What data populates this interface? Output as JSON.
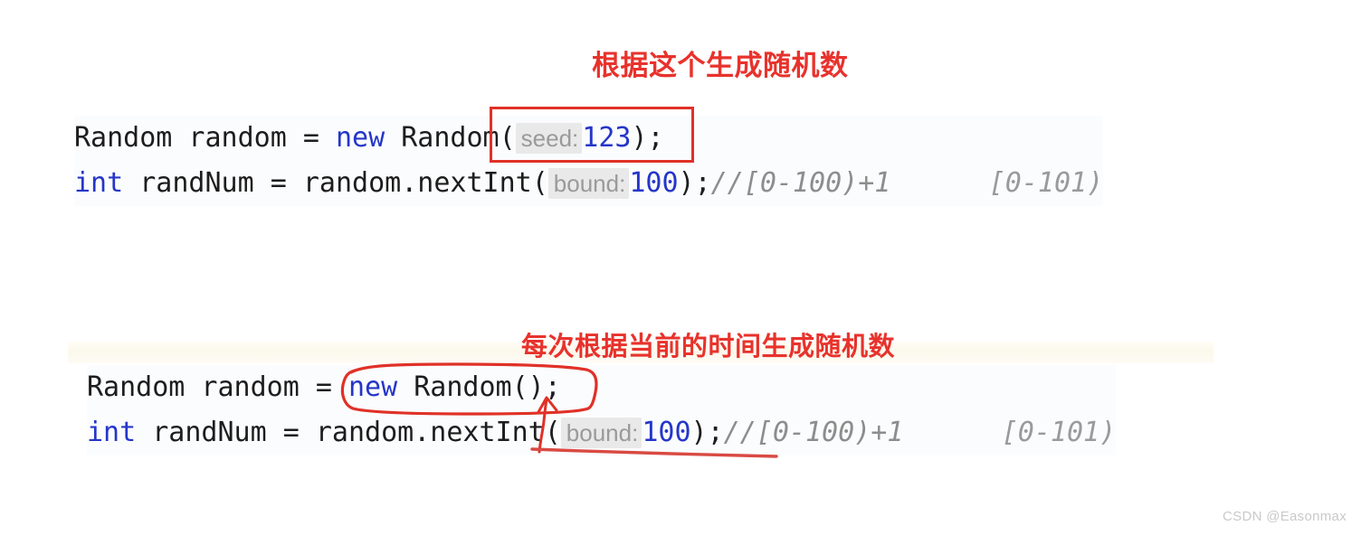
{
  "watermark": {
    "text": "CSDN @Easonmax"
  },
  "annotations": {
    "top": {
      "text": "根据这个生成随机数",
      "color": "#e8322c",
      "target": "seed-argument"
    },
    "bottom": {
      "text": "每次根据当前的时间生成随机数",
      "color": "#e8322c",
      "target": "new-random-no-arg"
    }
  },
  "highlights": {
    "red_rectangle": {
      "shape": "rectangle",
      "color": "#e03127",
      "encloses": "( seed: 123);"
    },
    "red_oval": {
      "shape": "hand-drawn-oval",
      "color": "#e03127",
      "encloses": "new Random();"
    },
    "red_underline": {
      "shape": "hand-drawn-underline",
      "color": "#e03127",
      "underlines": "( bound: 100);"
    },
    "red_arrow": {
      "shape": "hand-drawn-arrow",
      "color": "#e03127",
      "points_from": "bound-underline",
      "points_to": "new-random-oval"
    }
  },
  "code_blocks": [
    {
      "id": "block-1",
      "lines": [
        {
          "tokens": [
            {
              "type": "plain",
              "text": "Random random = "
            },
            {
              "type": "keyword",
              "text": "new"
            },
            {
              "type": "plain",
              "text": " Random("
            },
            {
              "type": "hint",
              "text": "seed:"
            },
            {
              "type": "number",
              "text": "123"
            },
            {
              "type": "plain",
              "text": ");"
            }
          ]
        },
        {
          "tokens": [
            {
              "type": "keyword",
              "text": "int"
            },
            {
              "type": "plain",
              "text": " randNum = random.nextInt("
            },
            {
              "type": "hint",
              "text": "bound:"
            },
            {
              "type": "number",
              "text": "100"
            },
            {
              "type": "plain",
              "text": ");"
            },
            {
              "type": "comment",
              "text": "//[0-100)+1"
            },
            {
              "type": "comment2",
              "text": "      [0-101)"
            }
          ]
        }
      ]
    },
    {
      "id": "block-2",
      "lines": [
        {
          "tokens": [
            {
              "type": "plain",
              "text": "Random random = "
            },
            {
              "type": "keyword",
              "text": "new"
            },
            {
              "type": "plain",
              "text": " Random();"
            }
          ]
        },
        {
          "tokens": [
            {
              "type": "keyword",
              "text": "int"
            },
            {
              "type": "plain",
              "text": " randNum = random.nextInt("
            },
            {
              "type": "hint",
              "text": "bound:"
            },
            {
              "type": "number",
              "text": "100"
            },
            {
              "type": "plain",
              "text": ");"
            },
            {
              "type": "comment",
              "text": "//[0-100)+1"
            },
            {
              "type": "comment2",
              "text": "      [0-101)"
            }
          ]
        }
      ]
    }
  ]
}
